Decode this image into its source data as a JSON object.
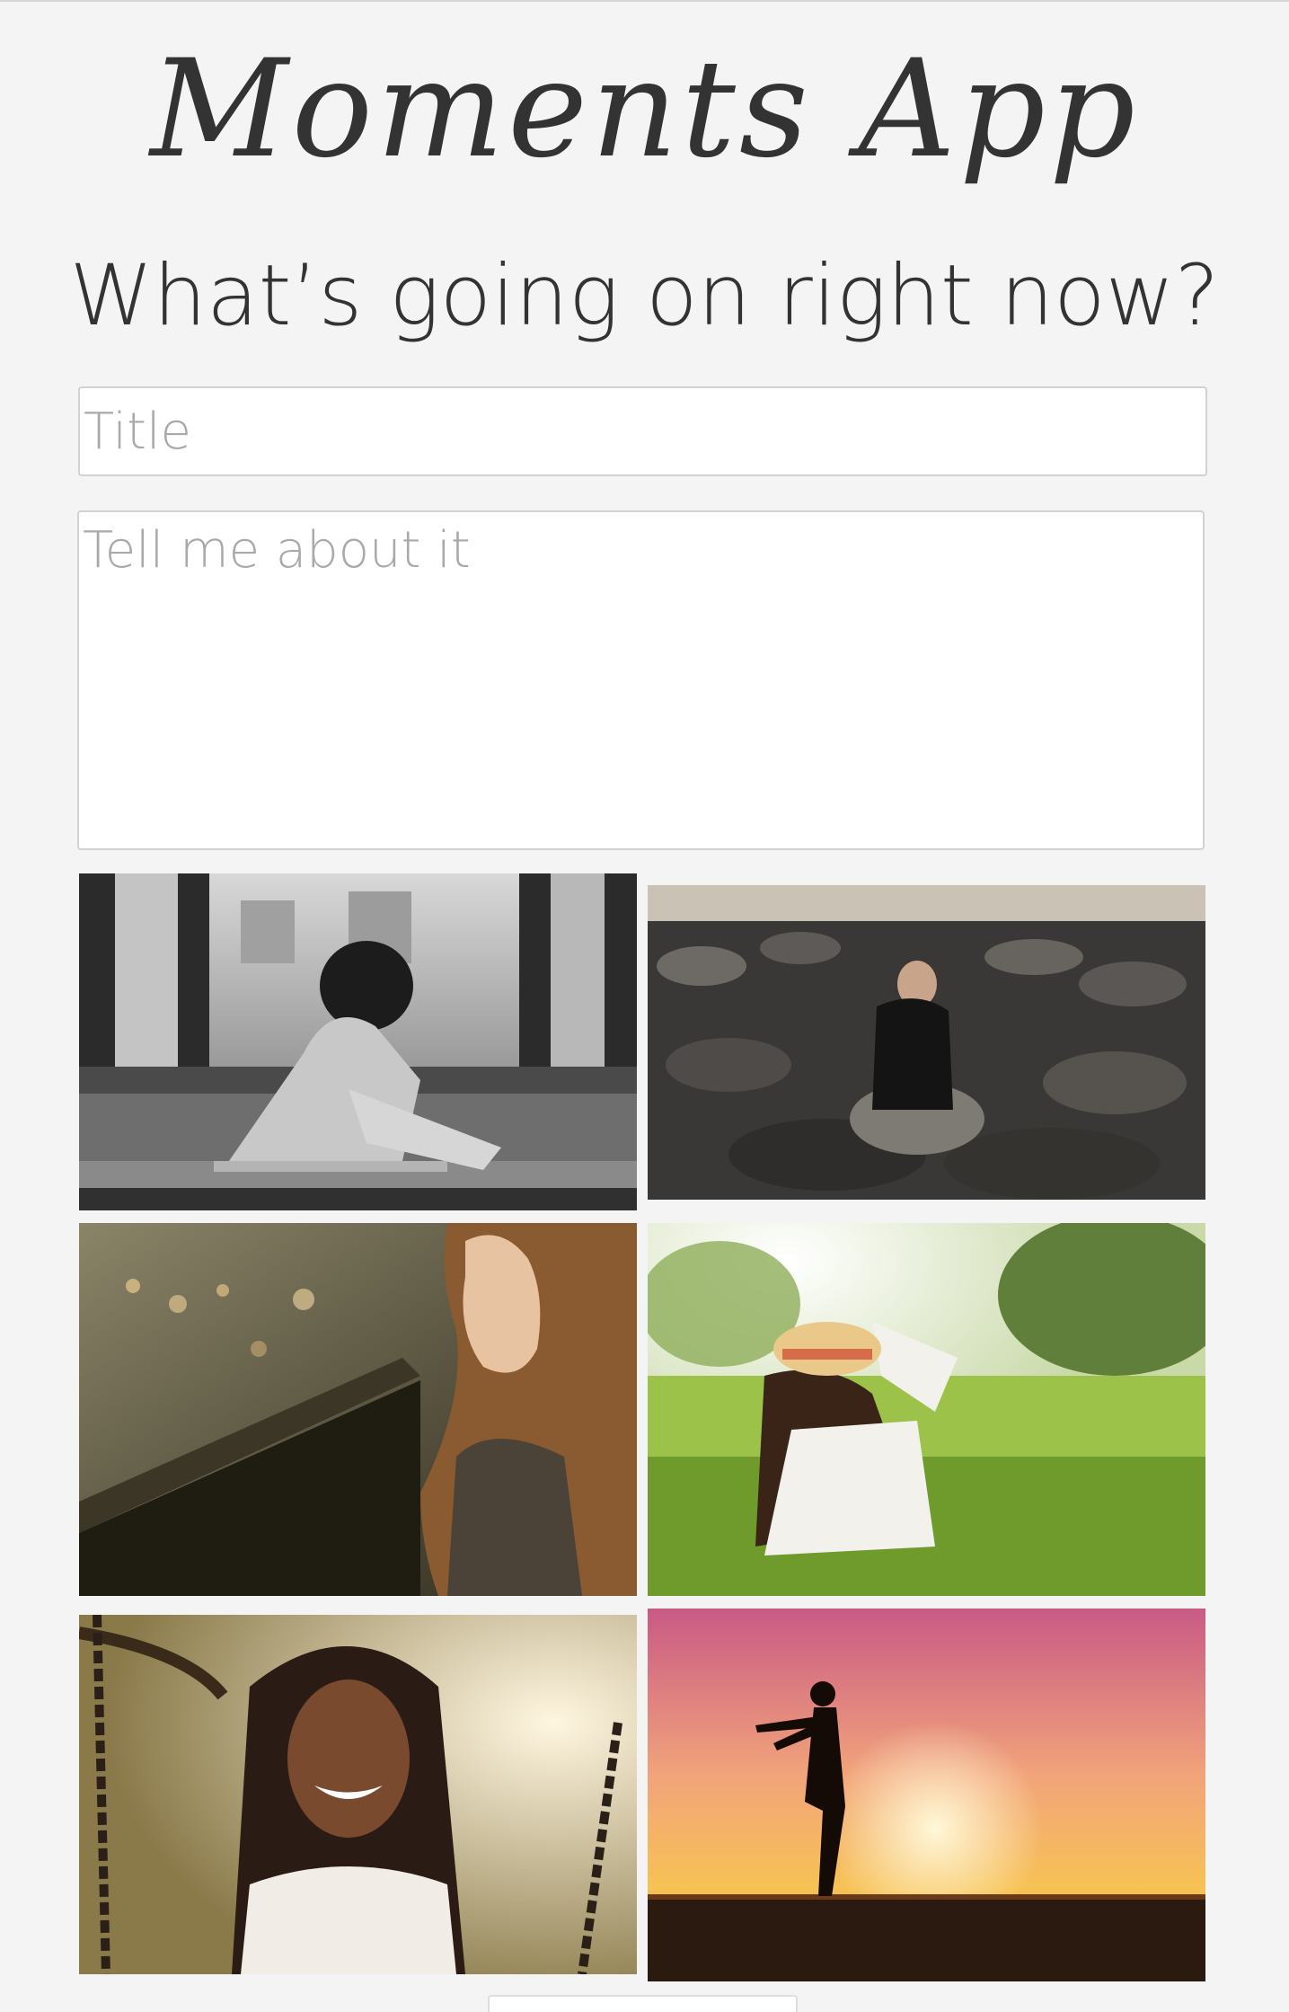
{
  "header": {
    "app_title": "Moments App",
    "tagline": "What’s going on right now?"
  },
  "form": {
    "title_placeholder": "Title",
    "title_value": "",
    "story_placeholder": "Tell me about it",
    "story_value": ""
  },
  "gallery": {
    "photos": [
      {
        "subject": "girl sitting by window, black and white"
      },
      {
        "subject": "woman sitting on rocks"
      },
      {
        "subject": "woman with long hair looking away"
      },
      {
        "subject": "girl in straw hat sitting in meadow"
      },
      {
        "subject": "smiling woman on swing"
      },
      {
        "subject": "silhouette of woman at sunset"
      }
    ]
  },
  "colors": {
    "background": "#f4f4f4",
    "text": "#333333",
    "placeholder": "#a9a9a9",
    "field_border": "#d2d2d2"
  }
}
